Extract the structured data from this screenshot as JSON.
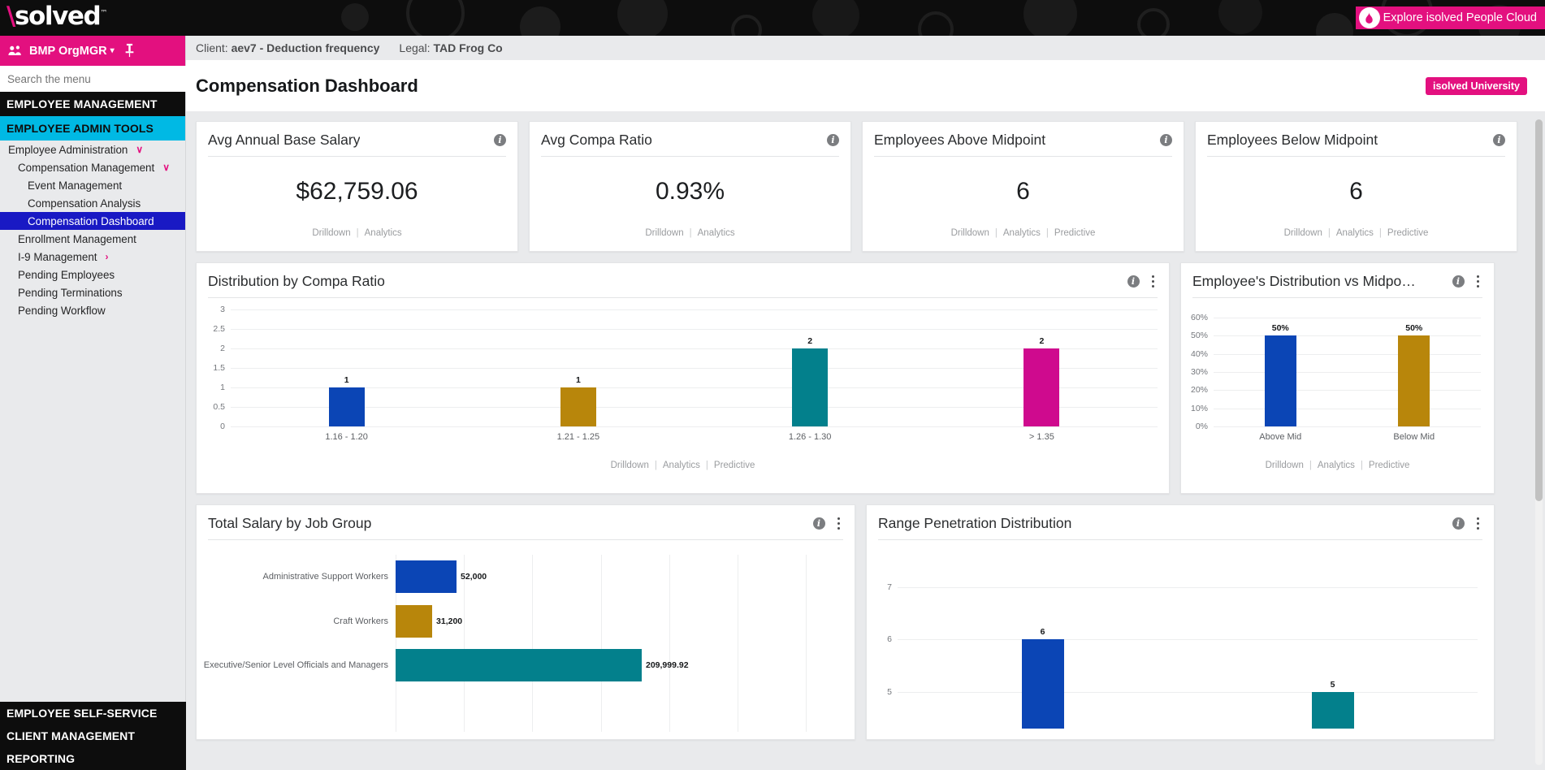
{
  "brand": {
    "logo_text": "solved",
    "logo_tm": "™",
    "explore_label": "Explore isolved People Cloud",
    "colors": {
      "pink": "#e3107f",
      "cyan": "#00b9e4",
      "active_blue": "#1919c4",
      "black": "#0d0d0d"
    }
  },
  "sidebar": {
    "org_label": "BMP OrgMGR",
    "org_caret": "▾",
    "people_icon": "people-icon",
    "pin_icon": "pin-icon",
    "search_placeholder": "Search the menu",
    "search_value": "",
    "section_employee_management": "EMPLOYEE MANAGEMENT",
    "section_employee_admin_tools": "EMPLOYEE ADMIN TOOLS",
    "items": [
      {
        "label": "Employee Administration",
        "level": 1,
        "chevron": "∨",
        "active": false
      },
      {
        "label": "Compensation Management",
        "level": 2,
        "chevron": "∨",
        "active": false
      },
      {
        "label": "Event Management",
        "level": 3,
        "chevron": "",
        "active": false
      },
      {
        "label": "Compensation Analysis",
        "level": 3,
        "chevron": "",
        "active": false
      },
      {
        "label": "Compensation Dashboard",
        "level": 3,
        "chevron": "",
        "active": true
      },
      {
        "label": "Enrollment Management",
        "level": 2,
        "chevron": "",
        "active": false
      },
      {
        "label": "I-9 Management",
        "level": 2,
        "chevron": "›",
        "active": false
      },
      {
        "label": "Pending Employees",
        "level": 2,
        "chevron": "",
        "active": false
      },
      {
        "label": "Pending Terminations",
        "level": 2,
        "chevron": "",
        "active": false
      },
      {
        "label": "Pending Workflow",
        "level": 2,
        "chevron": "",
        "active": false
      }
    ],
    "bottom_sections": [
      "EMPLOYEE SELF-SERVICE",
      "CLIENT MANAGEMENT",
      "REPORTING"
    ]
  },
  "header": {
    "client_label": "Client:",
    "client_value": "aev7 - Deduction frequency",
    "legal_label": "Legal:",
    "legal_value": "TAD Frog Co",
    "page_title": "Compensation Dashboard",
    "university_badge": "isolved University"
  },
  "links": {
    "drilldown": "Drilldown",
    "analytics": "Analytics",
    "predictive": "Predictive",
    "separator": "|"
  },
  "kpis": [
    {
      "title": "Avg Annual Base Salary",
      "value": "$62,759.06",
      "has_predictive": false
    },
    {
      "title": "Avg Compa Ratio",
      "value": "0.93%",
      "has_predictive": false
    },
    {
      "title": "Employees Above Midpoint",
      "value": "6",
      "has_predictive": true
    },
    {
      "title": "Employees Below Midpoint",
      "value": "6",
      "has_predictive": true
    }
  ],
  "chart_data": [
    {
      "id": "distribution-by-compa-ratio",
      "type": "bar",
      "title": "Distribution by Compa Ratio",
      "orientation": "vertical",
      "categories": [
        "1.16 - 1.20",
        "1.21 - 1.25",
        "1.26 - 1.30",
        "> 1.35"
      ],
      "values": [
        1,
        1,
        2,
        2
      ],
      "data_labels": [
        "1",
        "1",
        "2",
        "2"
      ],
      "colors": [
        "#0b45b5",
        "#b8860b",
        "#03808c",
        "#cf0a8e"
      ],
      "yticks": [
        "0",
        "0.5",
        "1",
        "1.5",
        "2",
        "2.5",
        "3"
      ],
      "ytick_values": [
        0,
        0.5,
        1,
        1.5,
        2,
        2.5,
        3
      ],
      "ylim": [
        0,
        3
      ],
      "xlabel": "",
      "ylabel": "",
      "grid": true,
      "legend": "none",
      "footer_links": [
        "Drilldown",
        "Analytics",
        "Predictive"
      ]
    },
    {
      "id": "employees-distribution-vs-midpoint",
      "type": "bar",
      "title": "Employee's Distribution vs Midpo…",
      "orientation": "vertical",
      "categories": [
        "Above Mid",
        "Below Mid"
      ],
      "values": [
        50,
        50
      ],
      "data_labels": [
        "50%",
        "50%"
      ],
      "colors": [
        "#0b45b5",
        "#b8860b"
      ],
      "yticks": [
        "0%",
        "10%",
        "20%",
        "30%",
        "40%",
        "50%",
        "60%"
      ],
      "ytick_values": [
        0,
        10,
        20,
        30,
        40,
        50,
        60
      ],
      "ylim": [
        0,
        60
      ],
      "xlabel": "",
      "ylabel": "",
      "grid": true,
      "legend": "none",
      "footer_links": [
        "Drilldown",
        "Analytics",
        "Predictive"
      ]
    },
    {
      "id": "total-salary-by-job-group",
      "type": "bar",
      "title": "Total Salary by Job Group",
      "orientation": "horizontal",
      "categories": [
        "Administrative Support Workers",
        "Craft Workers",
        "Executive/Senior Level Officials and Managers",
        ""
      ],
      "values": [
        52000,
        31200,
        209999.92,
        0
      ],
      "data_labels": [
        "52,000",
        "31,200",
        "209,999.92",
        ""
      ],
      "colors": [
        "#0b45b5",
        "#b8860b",
        "#03808c",
        "#e3107f"
      ],
      "xlim": [
        0,
        350000
      ],
      "grid": true,
      "legend": "none",
      "footer_links": []
    },
    {
      "id": "range-penetration-distribution",
      "type": "bar",
      "title": "Range Penetration Distribution",
      "orientation": "vertical",
      "categories": [
        "",
        ""
      ],
      "values": [
        6,
        5
      ],
      "data_labels": [
        "6",
        "5"
      ],
      "colors": [
        "#0b45b5",
        "#03808c"
      ],
      "yticks": [
        "5",
        "6",
        "7"
      ],
      "ytick_values": [
        5,
        6,
        7
      ],
      "ylim": [
        4.3,
        7.4
      ],
      "grid": true,
      "legend": "none",
      "footer_links": []
    }
  ]
}
